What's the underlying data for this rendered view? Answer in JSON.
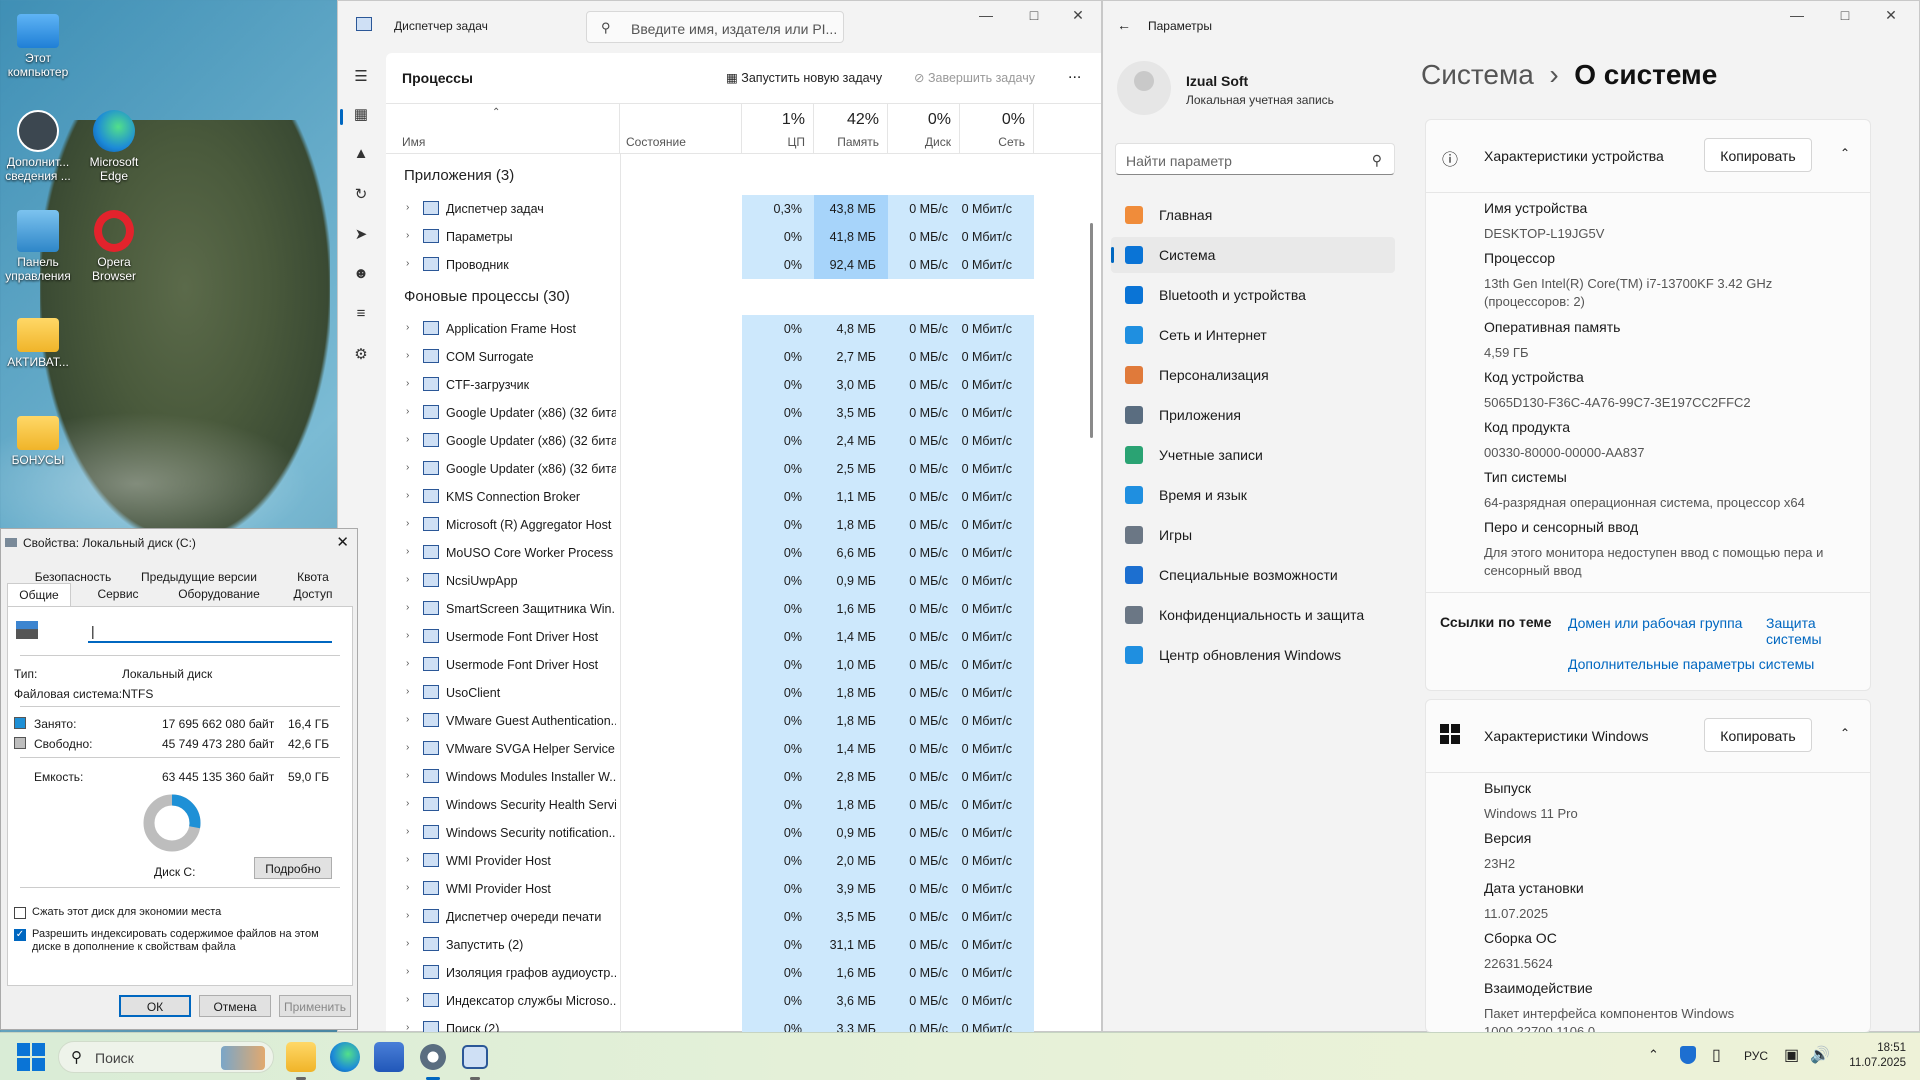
{
  "desktop": {
    "icons": [
      {
        "label": "Этот компьютер"
      },
      {
        "label": "Дополнит... сведения ..."
      },
      {
        "label": "Microsoft Edge"
      },
      {
        "label": "Панель управления"
      },
      {
        "label": "Opera Browser"
      },
      {
        "label": "АКТИВАТ..."
      },
      {
        "label": "БОНУСЫ"
      }
    ]
  },
  "taskmgr": {
    "title": "Диспетчер задач",
    "search_placeholder": "Введите имя, издателя или PI...",
    "page_title": "Процессы",
    "run_task": "Запустить новую задачу",
    "end_task": "Завершить задачу",
    "more": "...",
    "columns": {
      "name": "Имя",
      "status": "Состояние",
      "cpu_pct": "1%",
      "cpu": "ЦП",
      "mem_pct": "42%",
      "mem": "Память",
      "disk_pct": "0%",
      "disk": "Диск",
      "net_pct": "0%",
      "net": "Сеть"
    },
    "group_apps": "Приложения (3)",
    "group_bg": "Фоновые процессы (30)",
    "apps": [
      {
        "name": "Диспетчер задач",
        "cpu": "0,3%",
        "mem": "43,8 МБ",
        "disk": "0 МБ/с",
        "net": "0 Мбит/с"
      },
      {
        "name": "Параметры",
        "cpu": "0%",
        "mem": "41,8 МБ",
        "disk": "0 МБ/с",
        "net": "0 Мбит/с"
      },
      {
        "name": "Проводник",
        "cpu": "0%",
        "mem": "92,4 МБ",
        "disk": "0 МБ/с",
        "net": "0 Мбит/с"
      }
    ],
    "bg": [
      {
        "name": "Application Frame Host",
        "cpu": "0%",
        "mem": "4,8 МБ",
        "disk": "0 МБ/с",
        "net": "0 Мбит/с"
      },
      {
        "name": "COM Surrogate",
        "cpu": "0%",
        "mem": "2,7 МБ",
        "disk": "0 МБ/с",
        "net": "0 Мбит/с"
      },
      {
        "name": "CTF-загрузчик",
        "cpu": "0%",
        "mem": "3,0 МБ",
        "disk": "0 МБ/с",
        "net": "0 Мбит/с"
      },
      {
        "name": "Google Updater (x86) (32 бита...",
        "cpu": "0%",
        "mem": "3,5 МБ",
        "disk": "0 МБ/с",
        "net": "0 Мбит/с"
      },
      {
        "name": "Google Updater (x86) (32 бита...",
        "cpu": "0%",
        "mem": "2,4 МБ",
        "disk": "0 МБ/с",
        "net": "0 Мбит/с"
      },
      {
        "name": "Google Updater (x86) (32 бита...",
        "cpu": "0%",
        "mem": "2,5 МБ",
        "disk": "0 МБ/с",
        "net": "0 Мбит/с"
      },
      {
        "name": "KMS Connection Broker",
        "cpu": "0%",
        "mem": "1,1 МБ",
        "disk": "0 МБ/с",
        "net": "0 Мбит/с"
      },
      {
        "name": "Microsoft (R) Aggregator Host",
        "cpu": "0%",
        "mem": "1,8 МБ",
        "disk": "0 МБ/с",
        "net": "0 Мбит/с"
      },
      {
        "name": "MoUSO Core Worker Process",
        "cpu": "0%",
        "mem": "6,6 МБ",
        "disk": "0 МБ/с",
        "net": "0 Мбит/с"
      },
      {
        "name": "NcsiUwpApp",
        "cpu": "0%",
        "mem": "0,9 МБ",
        "disk": "0 МБ/с",
        "net": "0 Мбит/с"
      },
      {
        "name": "SmartScreen Защитника Win...",
        "cpu": "0%",
        "mem": "1,6 МБ",
        "disk": "0 МБ/с",
        "net": "0 Мбит/с"
      },
      {
        "name": "Usermode Font Driver Host",
        "cpu": "0%",
        "mem": "1,4 МБ",
        "disk": "0 МБ/с",
        "net": "0 Мбит/с"
      },
      {
        "name": "Usermode Font Driver Host",
        "cpu": "0%",
        "mem": "1,0 МБ",
        "disk": "0 МБ/с",
        "net": "0 Мбит/с"
      },
      {
        "name": "UsoClient",
        "cpu": "0%",
        "mem": "1,8 МБ",
        "disk": "0 МБ/с",
        "net": "0 Мбит/с"
      },
      {
        "name": "VMware Guest Authentication...",
        "cpu": "0%",
        "mem": "1,8 МБ",
        "disk": "0 МБ/с",
        "net": "0 Мбит/с"
      },
      {
        "name": "VMware SVGA Helper Service (...",
        "cpu": "0%",
        "mem": "1,4 МБ",
        "disk": "0 МБ/с",
        "net": "0 Мбит/с"
      },
      {
        "name": "Windows Modules Installer W...",
        "cpu": "0%",
        "mem": "2,8 МБ",
        "disk": "0 МБ/с",
        "net": "0 Мбит/с"
      },
      {
        "name": "Windows Security Health Servi...",
        "cpu": "0%",
        "mem": "1,8 МБ",
        "disk": "0 МБ/с",
        "net": "0 Мбит/с"
      },
      {
        "name": "Windows Security notification...",
        "cpu": "0%",
        "mem": "0,9 МБ",
        "disk": "0 МБ/с",
        "net": "0 Мбит/с"
      },
      {
        "name": "WMI Provider Host",
        "cpu": "0%",
        "mem": "2,0 МБ",
        "disk": "0 МБ/с",
        "net": "0 Мбит/с"
      },
      {
        "name": "WMI Provider Host",
        "cpu": "0%",
        "mem": "3,9 МБ",
        "disk": "0 МБ/с",
        "net": "0 Мбит/с"
      },
      {
        "name": "Диспетчер очереди печати",
        "cpu": "0%",
        "mem": "3,5 МБ",
        "disk": "0 МБ/с",
        "net": "0 Мбит/с"
      },
      {
        "name": "Запустить (2)",
        "cpu": "0%",
        "mem": "31,1 МБ",
        "disk": "0 МБ/с",
        "net": "0 Мбит/с"
      },
      {
        "name": "Изоляция графов аудиоустр...",
        "cpu": "0%",
        "mem": "1,6 МБ",
        "disk": "0 МБ/с",
        "net": "0 Мбит/с"
      },
      {
        "name": "Индексатор службы Microso...",
        "cpu": "0%",
        "mem": "3,6 МБ",
        "disk": "0 МБ/с",
        "net": "0 Мбит/с"
      },
      {
        "name": "Поиск (2)",
        "cpu": "0%",
        "mem": "3,3 МБ",
        "disk": "0 МБ/с",
        "net": "0 Мбит/с"
      }
    ]
  },
  "settings": {
    "title": "Параметры",
    "user_name": "Izual Soft",
    "user_type": "Локальная учетная запись",
    "search_placeholder": "Найти параметр",
    "nav": [
      {
        "label": "Главная"
      },
      {
        "label": "Система"
      },
      {
        "label": "Bluetooth и устройства"
      },
      {
        "label": "Сеть и Интернет"
      },
      {
        "label": "Персонализация"
      },
      {
        "label": "Приложения"
      },
      {
        "label": "Учетные записи"
      },
      {
        "label": "Время и язык"
      },
      {
        "label": "Игры"
      },
      {
        "label": "Специальные возможности"
      },
      {
        "label": "Конфиденциальность и защита"
      },
      {
        "label": "Центр обновления Windows"
      }
    ],
    "crumb_parent": "Система",
    "crumb_sep": "›",
    "crumb_current": "О системе",
    "device_card": {
      "title": "Характеристики устройства",
      "copy": "Копировать",
      "items": [
        {
          "k": "Имя устройства",
          "v": "DESKTOP-L19JG5V"
        },
        {
          "k": "Процессор",
          "v": "13th Gen Intel(R) Core(TM) i7-13700KF   3.42 GHz (процессоров: 2)"
        },
        {
          "k": "Оперативная память",
          "v": "4,59 ГБ"
        },
        {
          "k": "Код устройства",
          "v": "5065D130-F36C-4A76-99C7-3E197CC2FFC2"
        },
        {
          "k": "Код продукта",
          "v": "00330-80000-00000-AA837"
        },
        {
          "k": "Тип системы",
          "v": "64-разрядная операционная система, процессор x64"
        },
        {
          "k": "Перо и сенсорный ввод",
          "v": "Для этого монитора недоступен ввод с помощью пера и сенсорный ввод"
        }
      ],
      "links_label": "Ссылки по теме",
      "link1": "Домен или рабочая группа",
      "link2": "Защита системы",
      "link3": "Дополнительные параметры системы"
    },
    "win_card": {
      "title": "Характеристики Windows",
      "copy": "Копировать",
      "items": [
        {
          "k": "Выпуск",
          "v": "Windows 11 Pro"
        },
        {
          "k": "Версия",
          "v": "23H2"
        },
        {
          "k": "Дата установки",
          "v": "11.07.2025"
        },
        {
          "k": "Сборка ОС",
          "v": "22631.5624"
        },
        {
          "k": "Взаимодействие",
          "v": "Пакет интерфейса компонентов Windows 1000.22700.1106.0"
        }
      ]
    }
  },
  "props": {
    "title": "Свойства: Локальный диск (C:)",
    "tabs_top": [
      "Безопасность",
      "Предыдущие версии",
      "Квота"
    ],
    "tabs_bottom": [
      "Общие",
      "Сервис",
      "Оборудование",
      "Доступ"
    ],
    "type_label": "Тип:",
    "type_value": "Локальный диск",
    "fs_label": "Файловая система:",
    "fs_value": "NTFS",
    "used_label": "Занято:",
    "used_bytes": "17 695 662 080 байт",
    "used_gb": "16,4 ГБ",
    "free_label": "Свободно:",
    "free_bytes": "45 749 473 280 байт",
    "free_gb": "42,6 ГБ",
    "cap_label": "Емкость:",
    "cap_bytes": "63 445 135 360 байт",
    "cap_gb": "59,0 ГБ",
    "used_fraction": 0.279,
    "disk_label": "Диск C:",
    "details": "Подробно",
    "compress": "Сжать этот диск для экономии места",
    "index": "Разрешить индексировать содержимое файлов на этом диске в дополнение к свойствам файла",
    "ok": "ОК",
    "cancel": "Отмена",
    "apply": "Применить"
  },
  "taskbar": {
    "search": "Поиск",
    "lang": "РУС",
    "time": "18:51",
    "date": "11.07.2025"
  }
}
